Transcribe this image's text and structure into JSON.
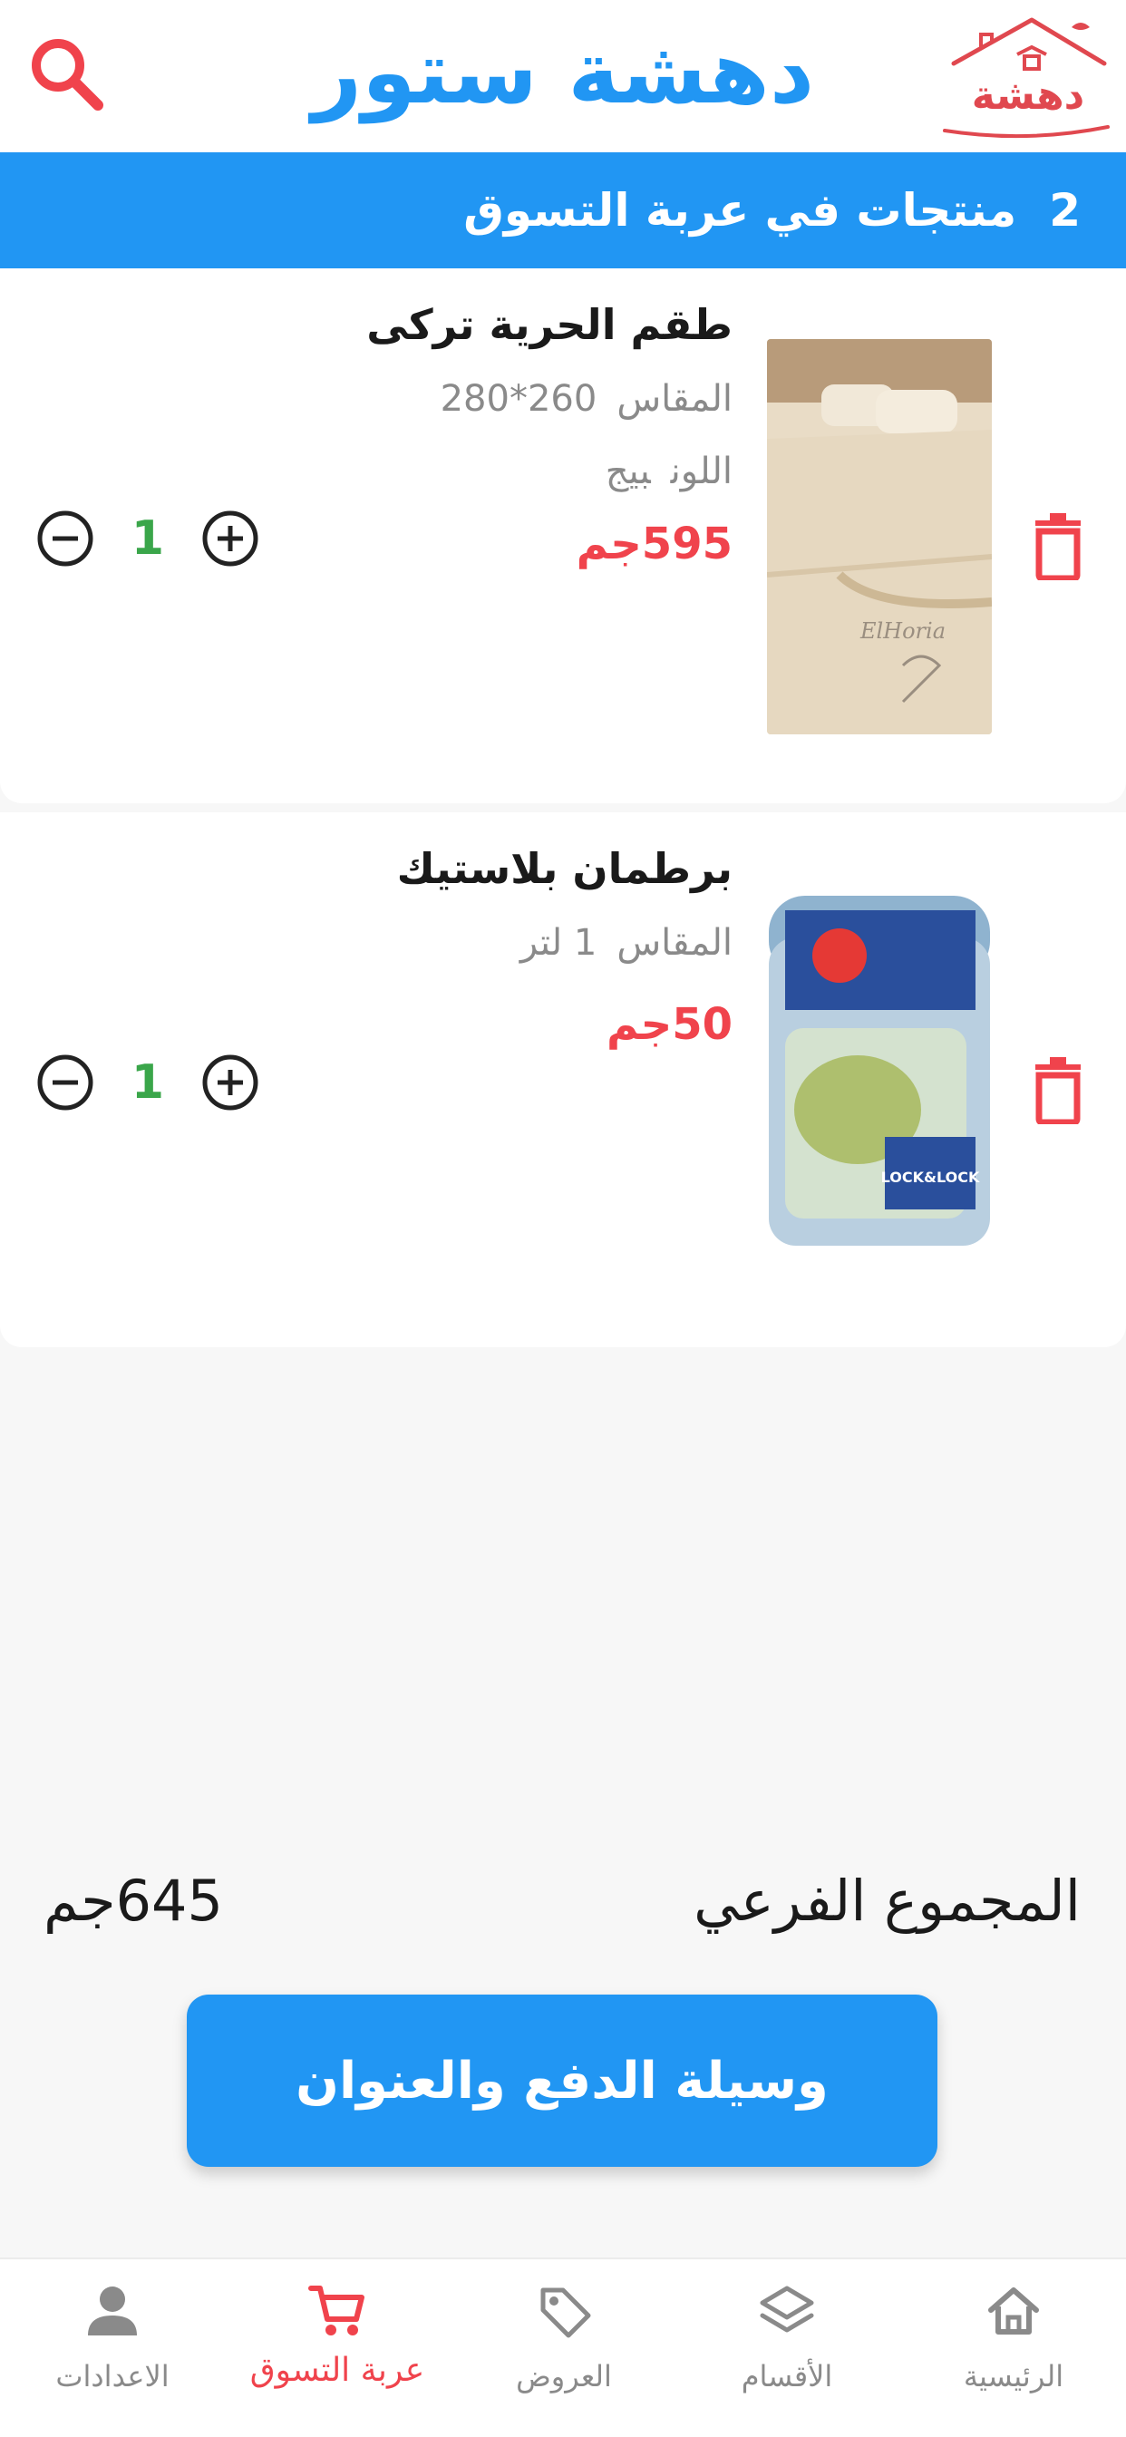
{
  "header": {
    "title": "دهشة ستور",
    "logo_text": "دهشة",
    "search_icon": "search-icon",
    "brand_color": "#2196F3",
    "accent_color": "#f0434c"
  },
  "cart_bar": {
    "count": "2",
    "text": "منتجات في عربة التسوق"
  },
  "items": [
    {
      "name": "طقم الحرية تركى",
      "size_label": "المقاس",
      "size_value": "260*280",
      "color_label": "اللون",
      "color_value": "بيج",
      "price": "595جم",
      "quantity": "1",
      "image_text": "ElHoria"
    },
    {
      "name": "برطمان بلاستيك",
      "size_label": "المقاس",
      "size_value": "1 لتر",
      "price": "50جم",
      "quantity": "1",
      "image_text": "LOCK&LOCK"
    }
  ],
  "summary": {
    "subtotal_label": "المجموع الفرعي",
    "subtotal_value": "645جم"
  },
  "checkout_label": "وسيلة الدفع والعنوان",
  "nav": {
    "home": "الرئيسية",
    "categories": "الأقسام",
    "offers": "العروض",
    "cart": "عربة التسوق",
    "settings": "الاعدادات",
    "active": "cart"
  }
}
